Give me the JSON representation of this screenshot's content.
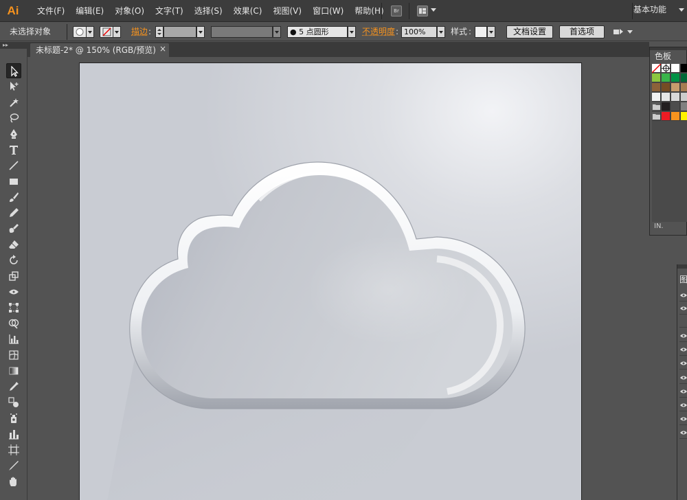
{
  "app": {
    "logo": "Ai",
    "workspace": "基本功能"
  },
  "menu": [
    "文件(F)",
    "编辑(E)",
    "对象(O)",
    "文字(T)",
    "选择(S)",
    "效果(C)",
    "视图(V)",
    "窗口(W)",
    "帮助(H)"
  ],
  "menubar_icons": {
    "bridge": "Br",
    "arrange": "arrange-documents-icon"
  },
  "control": {
    "selection": "未选择对象",
    "stroke_label": "描边",
    "brush_value": "5 点圆形",
    "opacity_label": "不透明度",
    "opacity_value": "100%",
    "style_label": "样式",
    "doc_setup": "文档设置",
    "prefs": "首选项"
  },
  "document_tab": {
    "title": "未标题-2* @ 150% (RGB/预览)",
    "close": "×"
  },
  "panels": {
    "swatches": {
      "title": "色板",
      "footer": "IN."
    },
    "layers": {
      "title": "图"
    }
  },
  "swatch_colors": [
    [
      "none",
      "#ffffff",
      "#ffffff",
      "#000000"
    ],
    [
      "#8dc63f",
      "#39b54a",
      "#009245",
      "#006837"
    ],
    [
      "#8c6239",
      "#754c24",
      "#c69c6d",
      "#a67c52"
    ],
    [
      "#f2f2f2",
      "#e6e6e6",
      "#d9d9d9",
      "#cccccc"
    ],
    [
      "folder",
      "#231f20",
      "#4d4d4d",
      "#808080"
    ],
    [
      "folder",
      "#ed1c24",
      "#f7931e",
      "#fff200"
    ]
  ],
  "colors": {
    "menubar": "#3c3c3c",
    "chrome": "#535353",
    "accent": "#f7931e"
  }
}
